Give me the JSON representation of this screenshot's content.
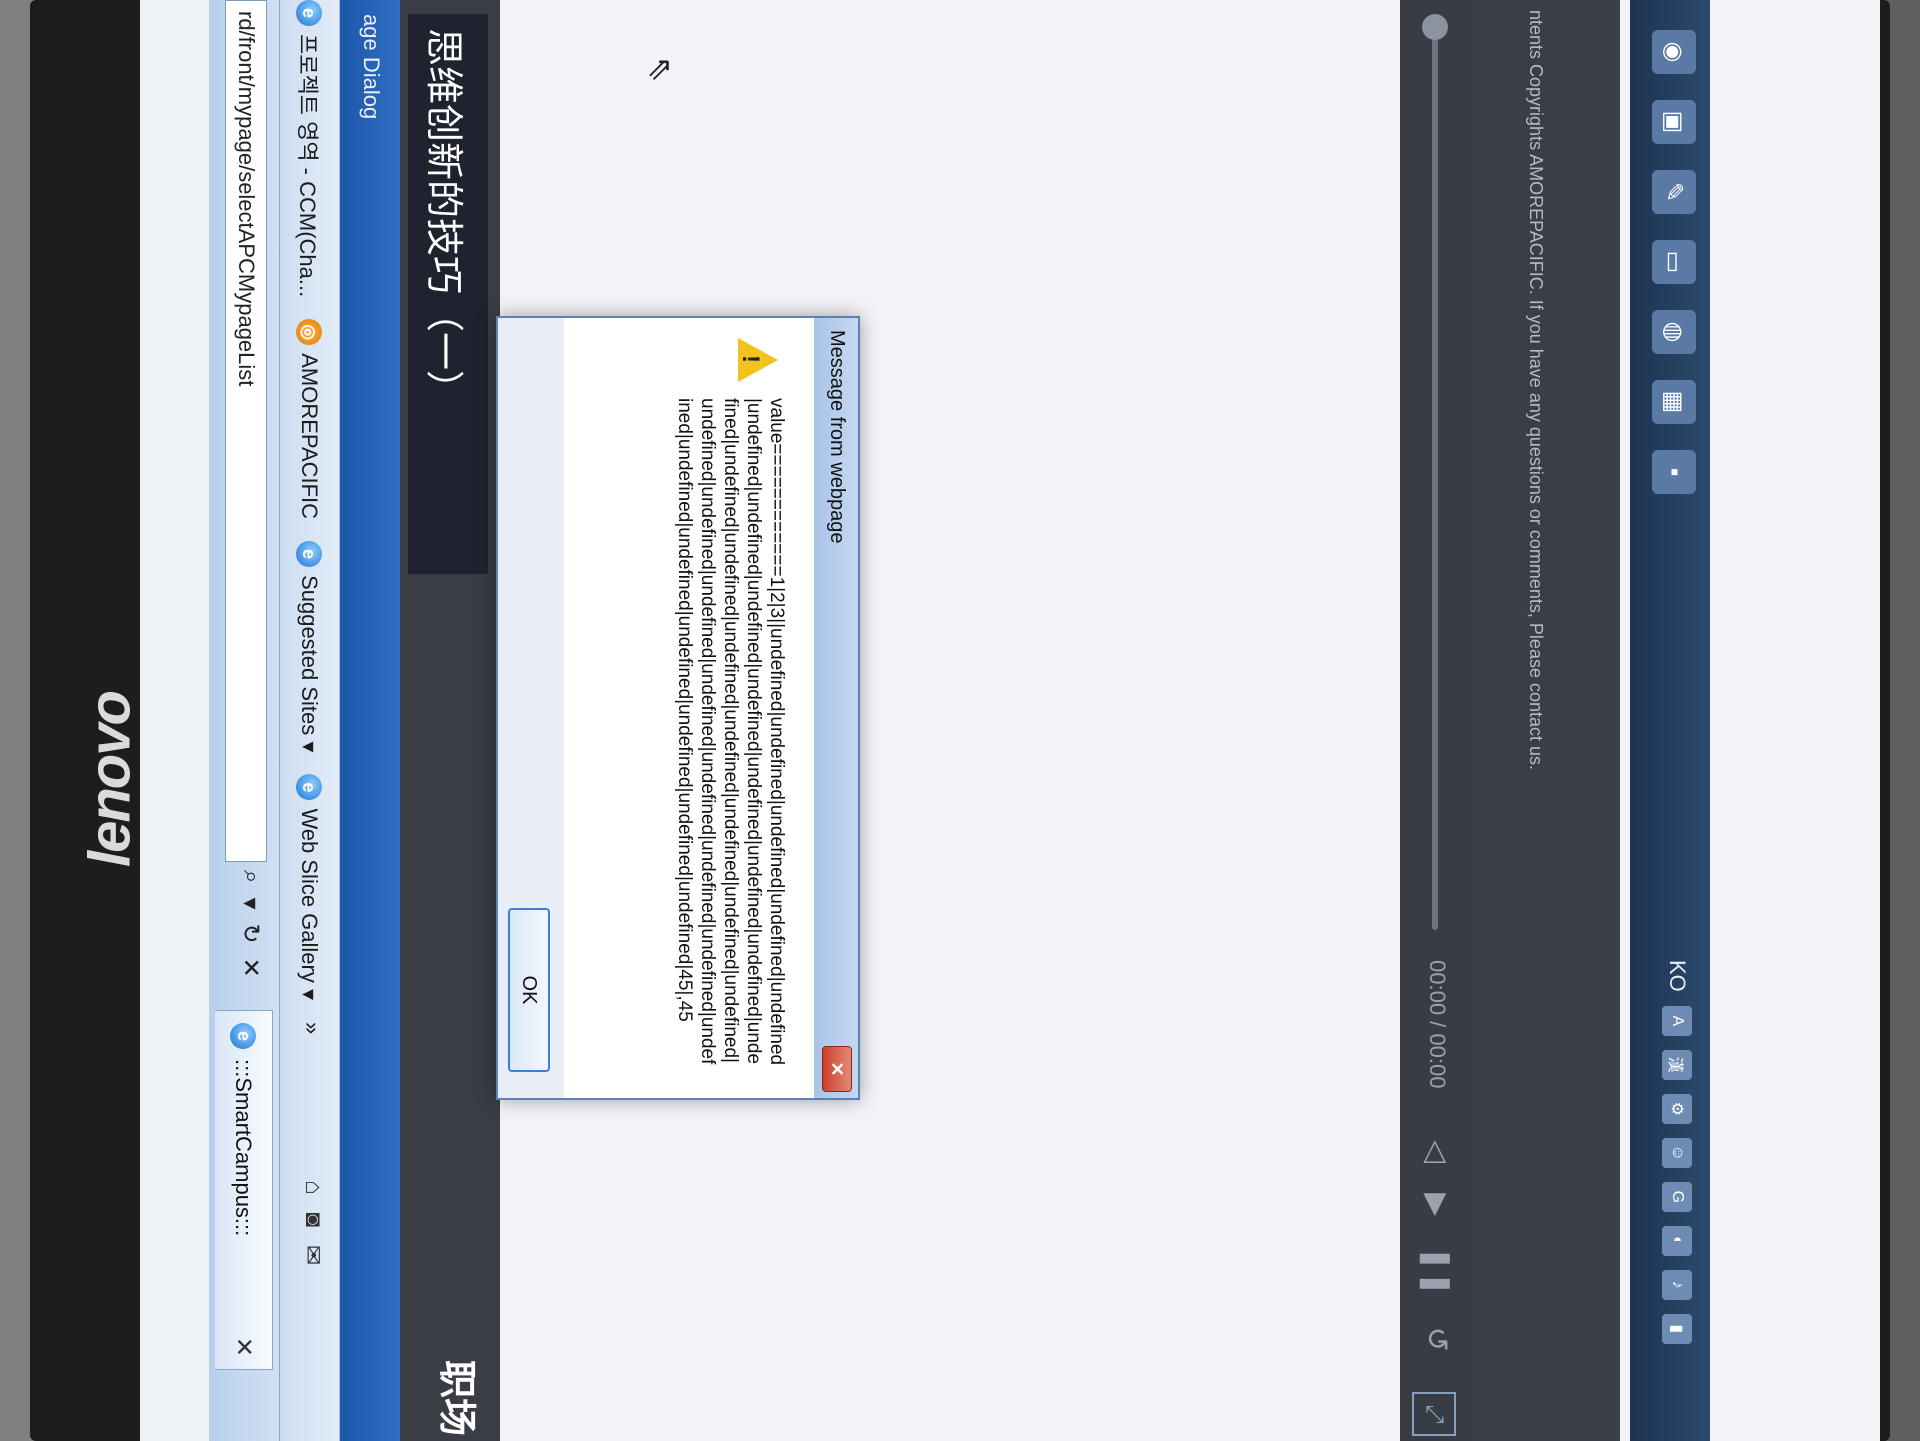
{
  "monitor": {
    "brand": "lenovo"
  },
  "browser": {
    "address_url": "rd/front/mypage/selectAPCMypageList",
    "address_controls": [
      "⌕",
      "▾",
      "↻",
      "✕"
    ],
    "tab": {
      "title": ":::SmartCampus:::",
      "close": "✕"
    },
    "favorites": [
      {
        "icon": "e",
        "label": "프로젝트 영역 - CCM(Cha..."
      },
      {
        "icon": "◎",
        "label": "AMOREPACIFIC"
      },
      {
        "icon": "e",
        "label": "Suggested Sites ▾"
      },
      {
        "icon": "e",
        "label": "Web Slice Gallery ▾"
      }
    ],
    "favorites_more": "»",
    "title_bar": "age Dialog"
  },
  "page": {
    "heading": "思维创新的技巧（一）",
    "side_label": "职场"
  },
  "media": {
    "time": "00:00 / 00:00"
  },
  "footer": {
    "text": "ntents Copyrights AMOREPACIFIC. If you have any questions or comments, Please contact us."
  },
  "taskbar": {
    "tray_lang": "KO",
    "tray_icon_A": "A",
    "tray_icon_han": "漢"
  },
  "dialog": {
    "title": "Message from webpage",
    "close": "✕",
    "message": "value============1|2|3||undefined|undefined|undefined|undefined|undefined|undefined|undefined|undefined|undefined|undefined|undefined|undefined|undefined|undefined|undefined|undefined|undefined|undefined|undefined|undefined|undefined|undefined|undefined|undefined|undefined|undefined|undefined|undefined|undefined|undefined|undefined|undefined|undefined|undefined|45|,45",
    "ok_label": "OK"
  }
}
